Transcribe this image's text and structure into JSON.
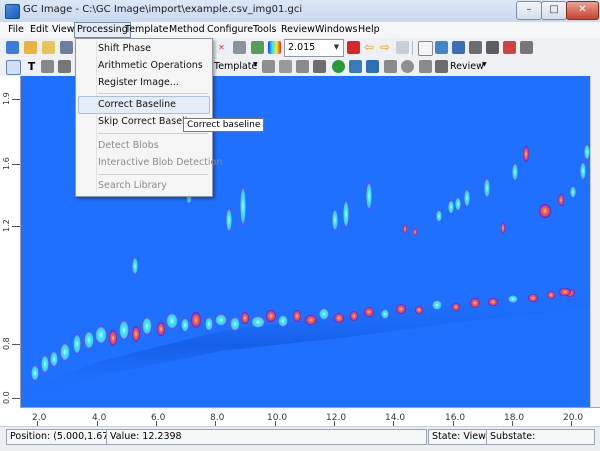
{
  "window": {
    "title": "GC Image - C:\\GC Image\\import\\example.csv_img01.gci",
    "minimize_symbol": "–",
    "maximize_symbol": "□",
    "close_symbol": "✕"
  },
  "menubar": {
    "items": [
      "File",
      "Edit",
      "View",
      "Processing",
      "Template",
      "Method",
      "Configure",
      "Tools",
      "Review",
      "Windows",
      "Help"
    ],
    "open_menu": "Processing"
  },
  "processing_menu": {
    "items": [
      {
        "label": "Shift Phase",
        "enabled": true
      },
      {
        "label": "Arithmetic Operations",
        "enabled": true
      },
      {
        "label": "Register Image...",
        "enabled": true
      },
      {
        "label": "Correct Baseline",
        "enabled": true,
        "highlighted": true
      },
      {
        "label": "Skip Correct Baseline",
        "enabled": true
      },
      {
        "label": "Detect Blobs",
        "enabled": false
      },
      {
        "label": "Interactive Blob Detection",
        "enabled": false
      },
      {
        "label": "Search Library",
        "enabled": false
      }
    ]
  },
  "tooltip": "Correct baseline",
  "toolbar": {
    "zoom_value": "2.015",
    "template_label": "Template",
    "review_label": "Review",
    "icons": [
      "open-icon",
      "save-icon",
      "zoom-icon",
      "text-icon",
      "colormap-icon",
      "stop-icon",
      "back-arrow-icon",
      "forward-arrow-icon"
    ]
  },
  "plot": {
    "x_ticks": [
      "2.0",
      "4.0",
      "6.0",
      "8.0",
      "10.0",
      "12.0",
      "14.0",
      "16.0",
      "18.0",
      "20.0"
    ],
    "y_ticks": [
      "0.0",
      "0.8",
      "1.2",
      "1.6",
      "1.9"
    ],
    "background_color": "#1f70ff"
  },
  "status": {
    "position": "Position: (5.000,1.675)",
    "value": "Value: 12.2398",
    "state": "State: View",
    "substate": "Substate:"
  }
}
